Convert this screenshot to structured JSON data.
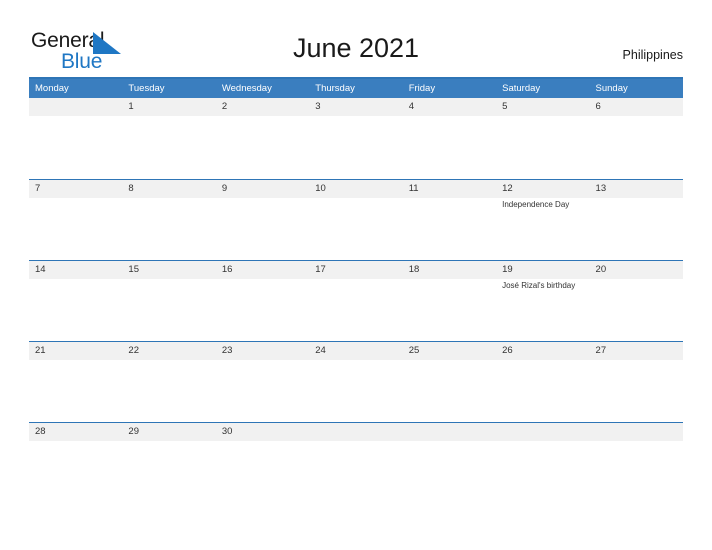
{
  "brand": {
    "name_part1": "General",
    "name_part2": "Blue",
    "accent_color": "#1f77c4",
    "triangle_icon": "brand-triangle-icon"
  },
  "header": {
    "title": "June 2021",
    "country": "Philippines"
  },
  "calendar": {
    "header_bg_color": "#3a7ebf",
    "row_line_color": "#2e75b6",
    "daynum_band_color": "#f1f1f1",
    "weekdays": [
      "Monday",
      "Tuesday",
      "Wednesday",
      "Thursday",
      "Friday",
      "Saturday",
      "Sunday"
    ],
    "weeks": [
      [
        {
          "day": "",
          "events": []
        },
        {
          "day": "1",
          "events": []
        },
        {
          "day": "2",
          "events": []
        },
        {
          "day": "3",
          "events": []
        },
        {
          "day": "4",
          "events": []
        },
        {
          "day": "5",
          "events": []
        },
        {
          "day": "6",
          "events": []
        }
      ],
      [
        {
          "day": "7",
          "events": []
        },
        {
          "day": "8",
          "events": []
        },
        {
          "day": "9",
          "events": []
        },
        {
          "day": "10",
          "events": []
        },
        {
          "day": "11",
          "events": []
        },
        {
          "day": "12",
          "events": [
            "Independence Day"
          ]
        },
        {
          "day": "13",
          "events": []
        }
      ],
      [
        {
          "day": "14",
          "events": []
        },
        {
          "day": "15",
          "events": []
        },
        {
          "day": "16",
          "events": []
        },
        {
          "day": "17",
          "events": []
        },
        {
          "day": "18",
          "events": []
        },
        {
          "day": "19",
          "events": [
            "José Rizal's birthday"
          ]
        },
        {
          "day": "20",
          "events": []
        }
      ],
      [
        {
          "day": "21",
          "events": []
        },
        {
          "day": "22",
          "events": []
        },
        {
          "day": "23",
          "events": []
        },
        {
          "day": "24",
          "events": []
        },
        {
          "day": "25",
          "events": []
        },
        {
          "day": "26",
          "events": []
        },
        {
          "day": "27",
          "events": []
        }
      ],
      [
        {
          "day": "28",
          "events": []
        },
        {
          "day": "29",
          "events": []
        },
        {
          "day": "30",
          "events": []
        },
        {
          "day": "",
          "events": []
        },
        {
          "day": "",
          "events": []
        },
        {
          "day": "",
          "events": []
        },
        {
          "day": "",
          "events": []
        }
      ]
    ]
  }
}
